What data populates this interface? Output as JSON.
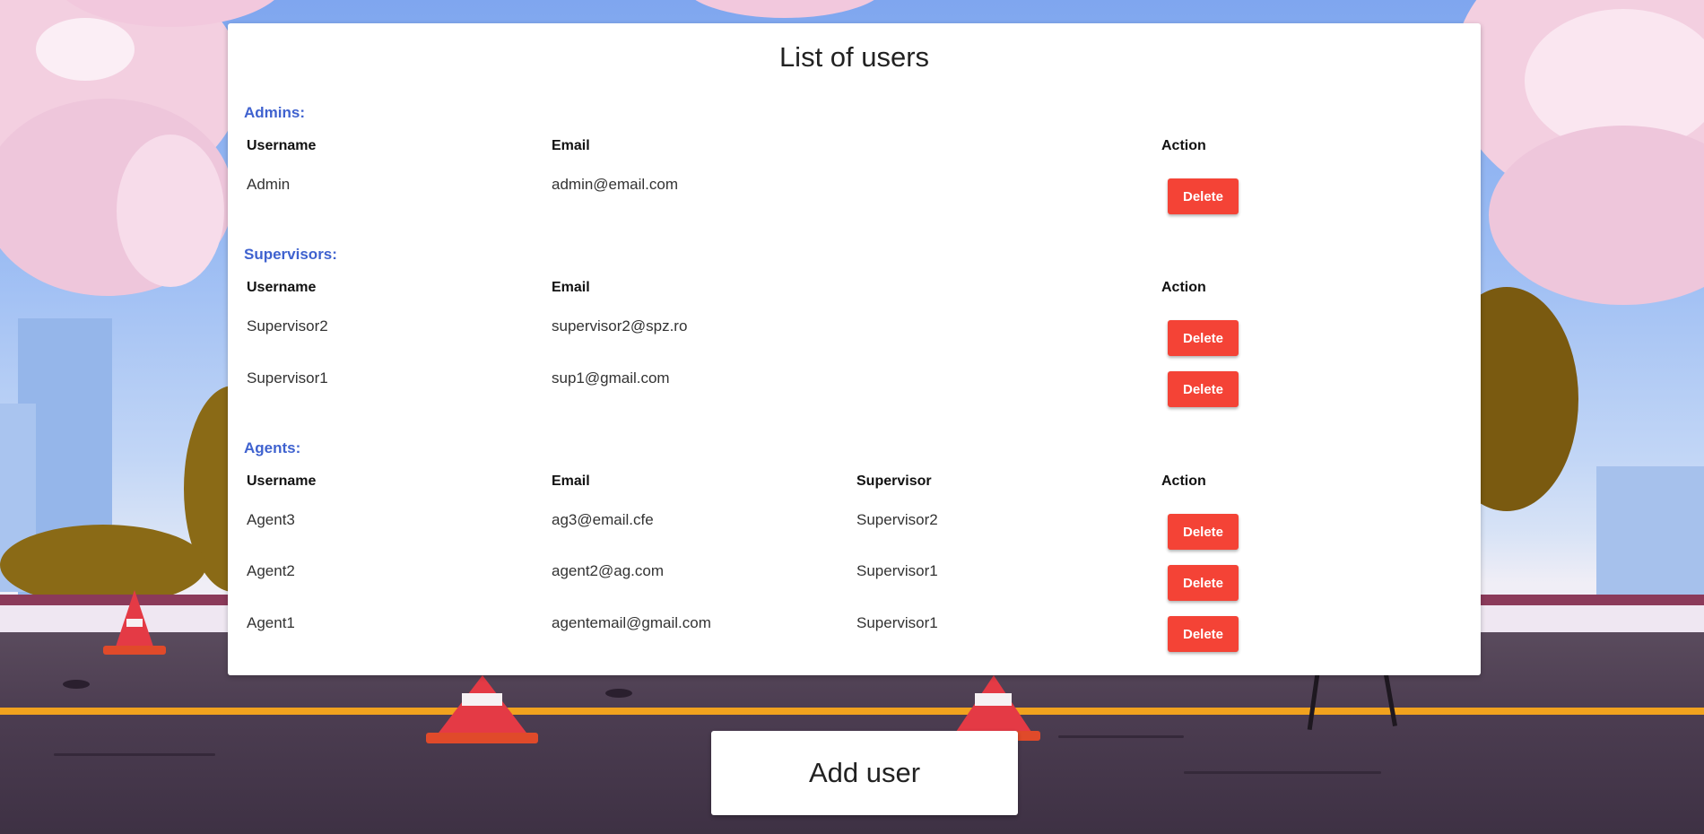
{
  "page": {
    "title": "List of users"
  },
  "colors": {
    "section_title": "#3f62cf",
    "delete_button": "#f44336"
  },
  "admins": {
    "title": "Admins:",
    "headers": {
      "username": "Username",
      "email": "Email",
      "action": "Action"
    },
    "rows": [
      {
        "username": "Admin",
        "email": "admin@email.com",
        "action": "Delete"
      }
    ]
  },
  "supervisors": {
    "title": "Supervisors:",
    "headers": {
      "username": "Username",
      "email": "Email",
      "action": "Action"
    },
    "rows": [
      {
        "username": "Supervisor2",
        "email": "supervisor2@spz.ro",
        "action": "Delete"
      },
      {
        "username": "Supervisor1",
        "email": "sup1@gmail.com",
        "action": "Delete"
      }
    ]
  },
  "agents": {
    "title": "Agents:",
    "headers": {
      "username": "Username",
      "email": "Email",
      "supervisor": "Supervisor",
      "action": "Action"
    },
    "rows": [
      {
        "username": "Agent3",
        "email": "ag3@email.cfe",
        "supervisor": "Supervisor2",
        "action": "Delete"
      },
      {
        "username": "Agent2",
        "email": "agent2@ag.com",
        "supervisor": "Supervisor1",
        "action": "Delete"
      },
      {
        "username": "Agent1",
        "email": "agentemail@gmail.com",
        "supervisor": "Supervisor1",
        "action": "Delete"
      }
    ]
  },
  "add_user_button": "Add user"
}
